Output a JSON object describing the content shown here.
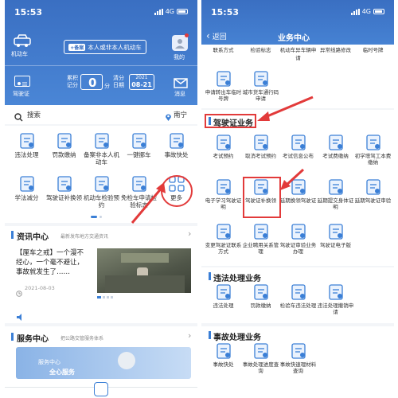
{
  "left": {
    "status": {
      "time": "15:53",
      "network": "4G"
    },
    "header": {
      "motor_label": "机动车",
      "plate_tag": "+备案",
      "plate_text": "本人或非本人机动车",
      "mine_label": "我的",
      "license_label": "驾驶证",
      "score_label_1": "累积",
      "score_label_2": "记分",
      "score_value": "0",
      "score_unit": "分",
      "clear_label_1": "清分",
      "clear_label_2": "日期",
      "clear_year": "2021",
      "clear_date": "08-21",
      "message_label": "消息"
    },
    "search": {
      "placeholder": "搜索",
      "city": "南宁"
    },
    "services": [
      {
        "label": "违法处理",
        "icon": "violation-icon"
      },
      {
        "label": "罚款缴纳",
        "icon": "fine-icon"
      },
      {
        "label": "备案非本人机动车",
        "icon": "register-car-icon"
      },
      {
        "label": "一键挪车",
        "icon": "move-car-icon"
      },
      {
        "label": "事故快处",
        "icon": "accident-icon"
      },
      {
        "label": "学法减分",
        "icon": "study-icon"
      },
      {
        "label": "驾驶证补换领",
        "icon": "license-replace-icon"
      },
      {
        "label": "机动车检验预约",
        "icon": "inspection-icon"
      },
      {
        "label": "免检车申请检验标志",
        "icon": "exempt-icon"
      },
      {
        "label": "更多",
        "icon": "more-grid-icon"
      }
    ],
    "news": {
      "title": "资讯中心",
      "subtitle": "最新发布地方交通资讯",
      "headline": "【厘车之戒】一个漫不经心，一个毫不避让，事故就发生了……",
      "date": "2021-08-03"
    },
    "service_center": {
      "title": "服务中心",
      "subtitle": "把公路交管服务体系",
      "banner_line1": "服务中心",
      "banner_line2": "全心服务"
    }
  },
  "right": {
    "status": {
      "time": "15:53",
      "network": "4G"
    },
    "nav": {
      "back": "返回",
      "title": "业务中心"
    },
    "top_partial": [
      "联系方式",
      "检验标志",
      "机动车异车辆申请",
      "异常线路修改",
      "临时号牌"
    ],
    "top_row2": [
      {
        "label": "申请转出车临时号牌",
        "icon": "temp-plate-icon"
      },
      {
        "label": "城市货车通行码申请",
        "icon": "truck-icon"
      }
    ],
    "license_section": {
      "title": "驾驶证业务",
      "items": [
        {
          "label": "考试预约",
          "icon": "exam-book-icon"
        },
        {
          "label": "取消考试预约",
          "icon": "cancel-exam-icon"
        },
        {
          "label": "考试信息公布",
          "icon": "exam-info-icon"
        },
        {
          "label": "考试费缴纳",
          "icon": "exam-fee-icon"
        },
        {
          "label": "初学增驾工本费缴纳",
          "icon": "fee-icon"
        },
        {
          "label": "电子学习驾驶证明",
          "icon": "e-study-icon"
        },
        {
          "label": "驾驶证补换领",
          "icon": "license-replace-icon"
        },
        {
          "label": "延期换领驾驶证",
          "icon": "renew-icon"
        },
        {
          "label": "延期提交身体证明",
          "icon": "health-icon"
        },
        {
          "label": "延期驾驶证审验",
          "icon": "audit-icon"
        },
        {
          "label": "变更驾驶证联系方式",
          "icon": "contact-icon"
        },
        {
          "label": "企业聘用关系管理",
          "icon": "enterprise-icon"
        },
        {
          "label": "驾驶证审验业务办理",
          "icon": "audit-process-icon"
        },
        {
          "label": "驾驶证电子版",
          "icon": "e-license-icon"
        }
      ]
    },
    "violation_section": {
      "title": "违法处理业务",
      "items": [
        {
          "label": "违法处理",
          "icon": "violation-icon"
        },
        {
          "label": "罚款缴纳",
          "icon": "fine-icon"
        },
        {
          "label": "检验车违法处理",
          "icon": "inspect-violation-icon"
        },
        {
          "label": "违法处理撤销申请",
          "icon": "revoke-icon"
        }
      ]
    },
    "accident_section": {
      "title": "事故处理业务",
      "items": [
        {
          "label": "事故快处",
          "icon": "accident-icon"
        },
        {
          "label": "事故处理进度查询",
          "icon": "progress-icon"
        },
        {
          "label": "事故快速理材料查询",
          "icon": "material-icon"
        }
      ]
    }
  },
  "colors": {
    "brand_blue": "#3c76c9",
    "accent_red": "#e23a3a",
    "icon_blue": "#3b7fd6"
  }
}
